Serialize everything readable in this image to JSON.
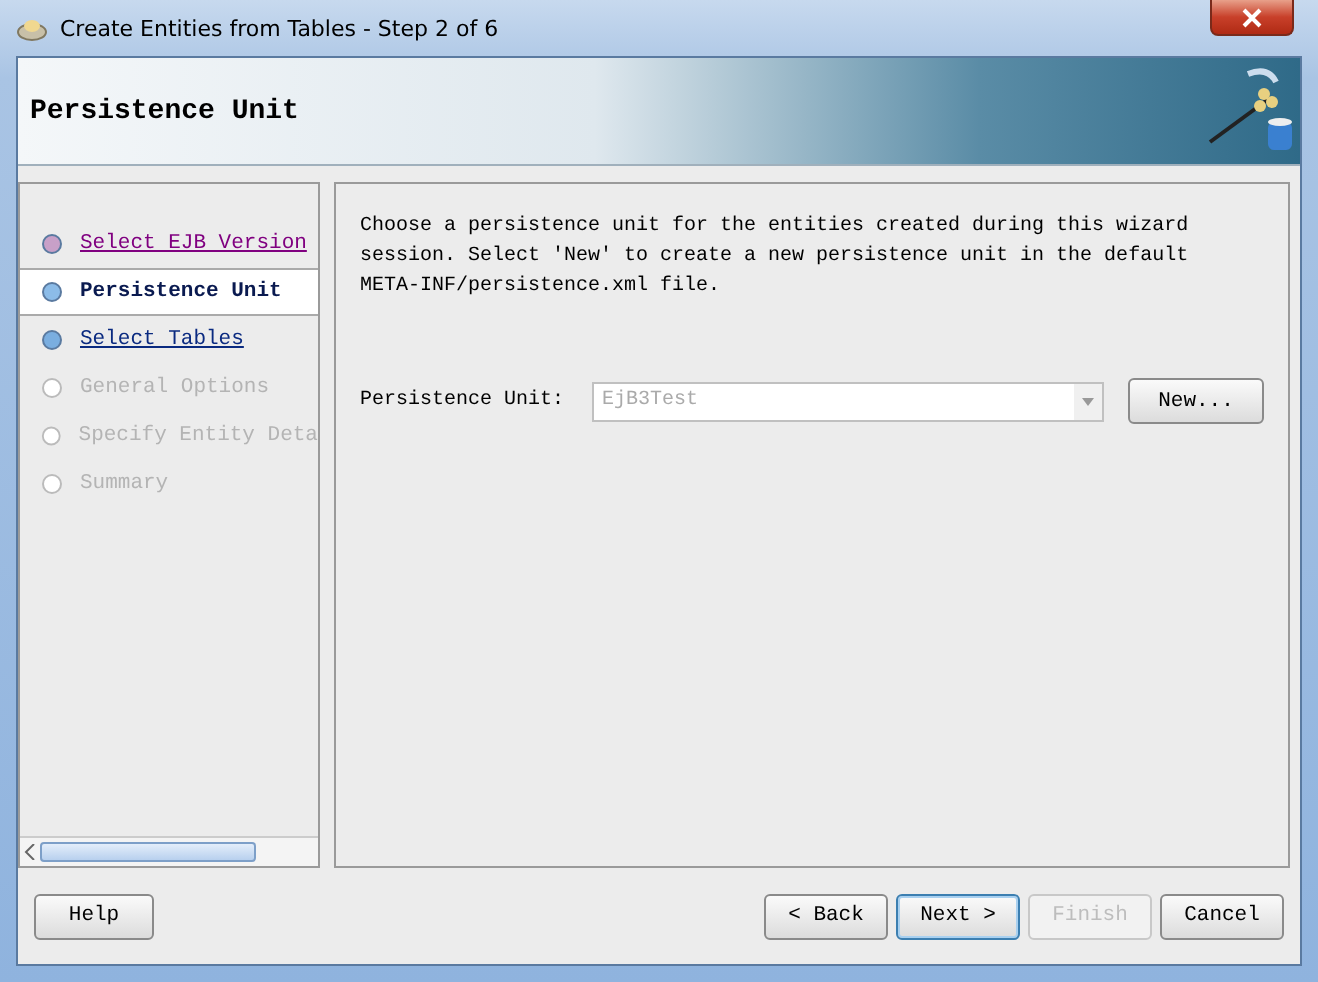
{
  "window": {
    "title": "Create Entities from Tables - Step 2 of 6"
  },
  "header": {
    "title": "Persistence Unit"
  },
  "steps": [
    {
      "label": "Select EJB Version",
      "kind": "visited",
      "selected": false
    },
    {
      "label": "Persistence Unit",
      "kind": "current",
      "selected": true
    },
    {
      "label": "Select Tables",
      "kind": "available",
      "selected": false
    },
    {
      "label": "General Options",
      "kind": "disabled",
      "selected": false
    },
    {
      "label": "Specify Entity Deta",
      "kind": "disabled",
      "selected": false
    },
    {
      "label": "Summary",
      "kind": "disabled",
      "selected": false
    }
  ],
  "content": {
    "description": "Choose a persistence unit for the entities created during this wizard session.  Select 'New' to create a new persistence unit in the default META-INF/persistence.xml file.",
    "unit_label": "Persistence Unit:",
    "unit_value": "EjB3Test",
    "unit_disabled": true,
    "new_button": "New..."
  },
  "buttons": [
    {
      "label": "Help",
      "kind": "help",
      "disabled": false,
      "selected": false
    },
    {
      "label": "< Back",
      "kind": "nav",
      "disabled": false,
      "selected": false
    },
    {
      "label": "Next >",
      "kind": "nav",
      "disabled": false,
      "selected": true
    },
    {
      "label": "Finish",
      "kind": "nav",
      "disabled": true,
      "selected": false
    },
    {
      "label": "Cancel",
      "kind": "nav",
      "disabled": false,
      "selected": false
    }
  ]
}
